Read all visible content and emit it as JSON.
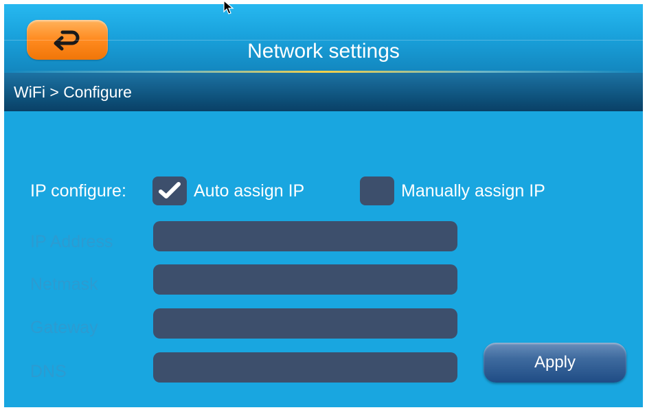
{
  "header": {
    "title": "Network settings",
    "back_icon": "return-arrow-icon"
  },
  "breadcrumb": {
    "text": "WiFi > Configure"
  },
  "ip_config": {
    "label": "IP configure:",
    "auto": {
      "label": "Auto assign IP",
      "checked": true
    },
    "manual": {
      "label": "Manually assign IP",
      "checked": false
    }
  },
  "fields": {
    "ip_address": {
      "label": "IP Address",
      "value": ""
    },
    "netmask": {
      "label": "Netmask",
      "value": ""
    },
    "gateway": {
      "label": "Gateway",
      "value": ""
    },
    "dns": {
      "label": "DNS",
      "value": ""
    }
  },
  "actions": {
    "apply_label": "Apply"
  },
  "colors": {
    "background": "#19a6e0",
    "back_button": "#ff8a1f",
    "input_fill": "#3d4f6c",
    "breadcrumb_bar": "#0d4f78",
    "disabled_label": "#2c9bd1"
  }
}
